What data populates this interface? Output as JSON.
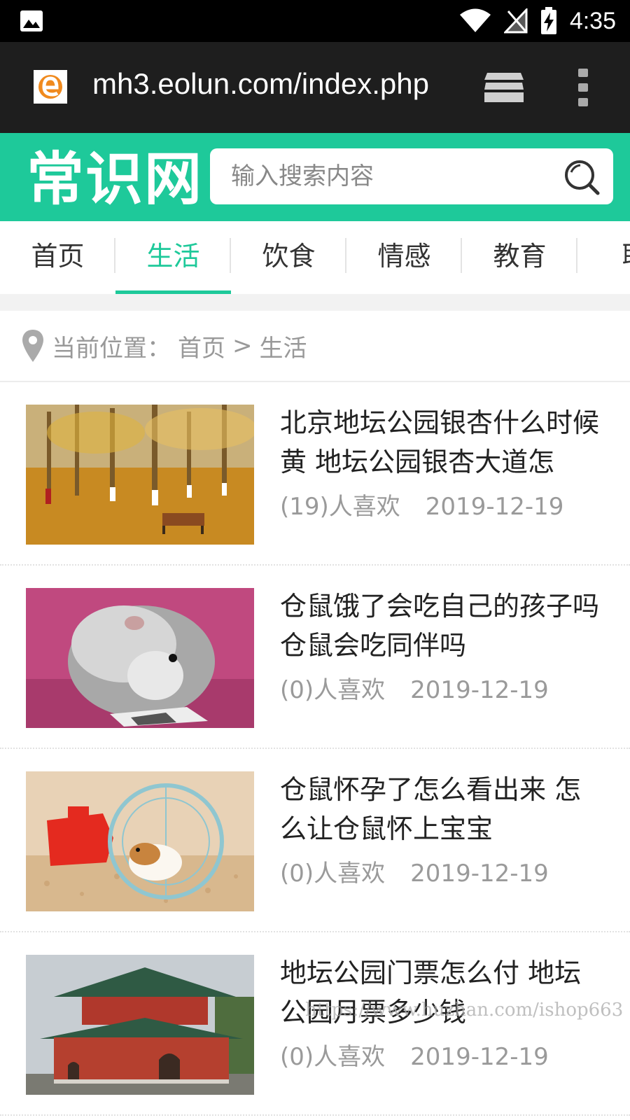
{
  "status_bar": {
    "time": "4:35"
  },
  "browser": {
    "url": "mh3.eolun.com/index.php"
  },
  "header": {
    "logo": "常识网",
    "search_placeholder": "输入搜索内容",
    "accent": "#1ec99a"
  },
  "nav": {
    "tabs": [
      {
        "label": "首页"
      },
      {
        "label": "生活"
      },
      {
        "label": "饮食"
      },
      {
        "label": "情感"
      },
      {
        "label": "教育"
      },
      {
        "label": "职"
      }
    ],
    "active_index": 1
  },
  "breadcrumb": {
    "prefix": "当前位置：",
    "home": "首页",
    "separator": ">",
    "current": "生活"
  },
  "articles": [
    {
      "title": "北京地坛公园银杏什么时候黄 地坛公园银杏大道怎",
      "likes": "(19)人喜欢",
      "date": "2019-12-19"
    },
    {
      "title": "仓鼠饿了会吃自己的孩子吗 仓鼠会吃同伴吗",
      "likes": "(0)人喜欢",
      "date": "2019-12-19"
    },
    {
      "title": "仓鼠怀孕了怎么看出来 怎么让仓鼠怀上宝宝",
      "likes": "(0)人喜欢",
      "date": "2019-12-19"
    },
    {
      "title": "地坛公园门票怎么付 地坛公园月票多少钱",
      "likes": "(0)人喜欢",
      "date": "2019-12-19"
    }
  ],
  "watermark": "https://www.huzhan.com/ishop663"
}
